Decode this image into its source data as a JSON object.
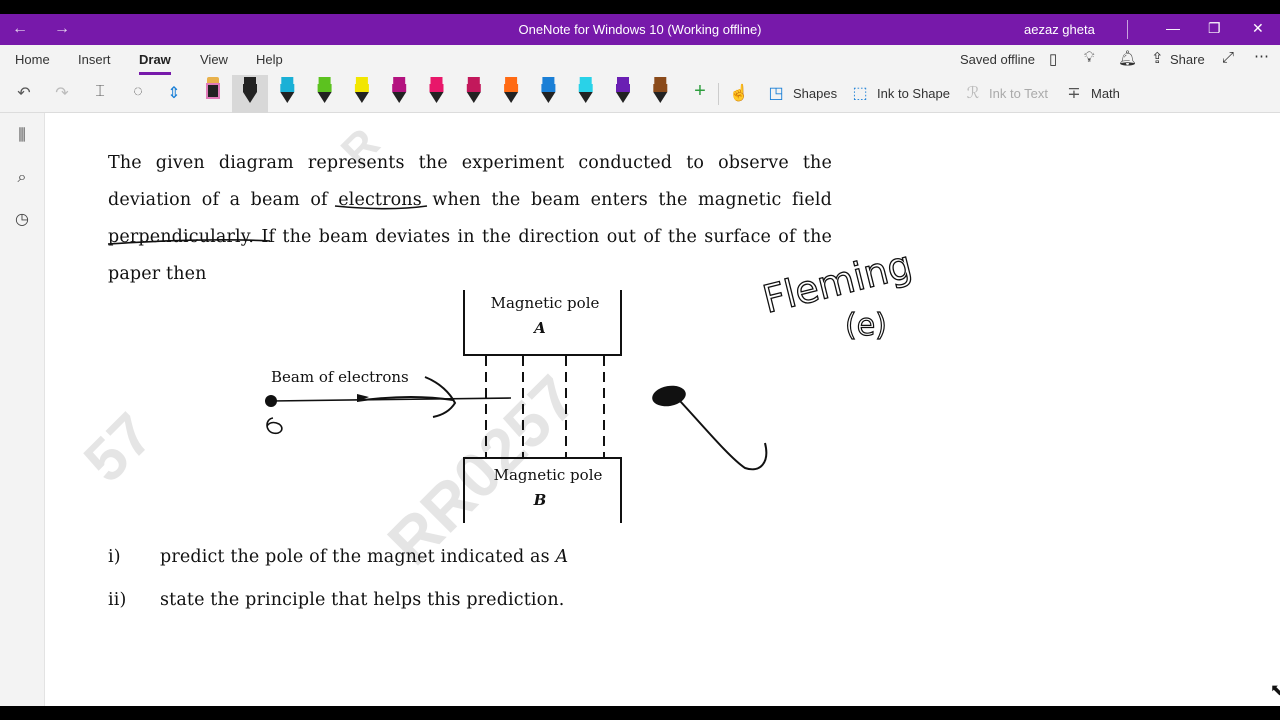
{
  "window": {
    "title": "OneNote for Windows 10 (Working offline)",
    "user": "aezaz gheta",
    "back_icon": "back-arrow-icon",
    "forward_icon": "forward-arrow-icon"
  },
  "menu": {
    "tabs": [
      "Home",
      "Insert",
      "Draw",
      "View",
      "Help"
    ],
    "active_tab": "Draw",
    "status": "Saved offline",
    "share": "Share"
  },
  "toolbar": {
    "shapes": "Shapes",
    "ink_to_shape": "Ink to Shape",
    "ink_to_text": "Ink to Text",
    "math": "Math",
    "pen_colors": [
      "#222222",
      "#1ab0d6",
      "#5cc21f",
      "#f2e600",
      "#b3127f",
      "#e8176a",
      "#c2185b",
      "#ff6a13",
      "#1a7fd6",
      "#29d2e8",
      "#6a1fb3",
      "#8a4a1a"
    ]
  },
  "note": {
    "paragraph": "The given diagram represents the experiment conducted to observe the deviation of a beam of electrons when the beam enters the magnetic field perpendicularly. If the beam deviates in the direction out of the surface of the paper then",
    "diagram": {
      "pole_a_label": "Magnetic pole",
      "pole_a_letter": "A",
      "pole_b_label": "Magnetic pole",
      "pole_b_letter": "B",
      "beam_label": "Beam of electrons"
    },
    "items": [
      {
        "num": "i)",
        "text_before": "predict the pole of the magnet indicated as ",
        "italic": "A"
      },
      {
        "num": "ii)",
        "text_before": "state the principle that helps this prediction.",
        "italic": ""
      }
    ],
    "watermark": "RR0257",
    "handwriting": "Fleming",
    "handwriting_2": "(e)"
  }
}
